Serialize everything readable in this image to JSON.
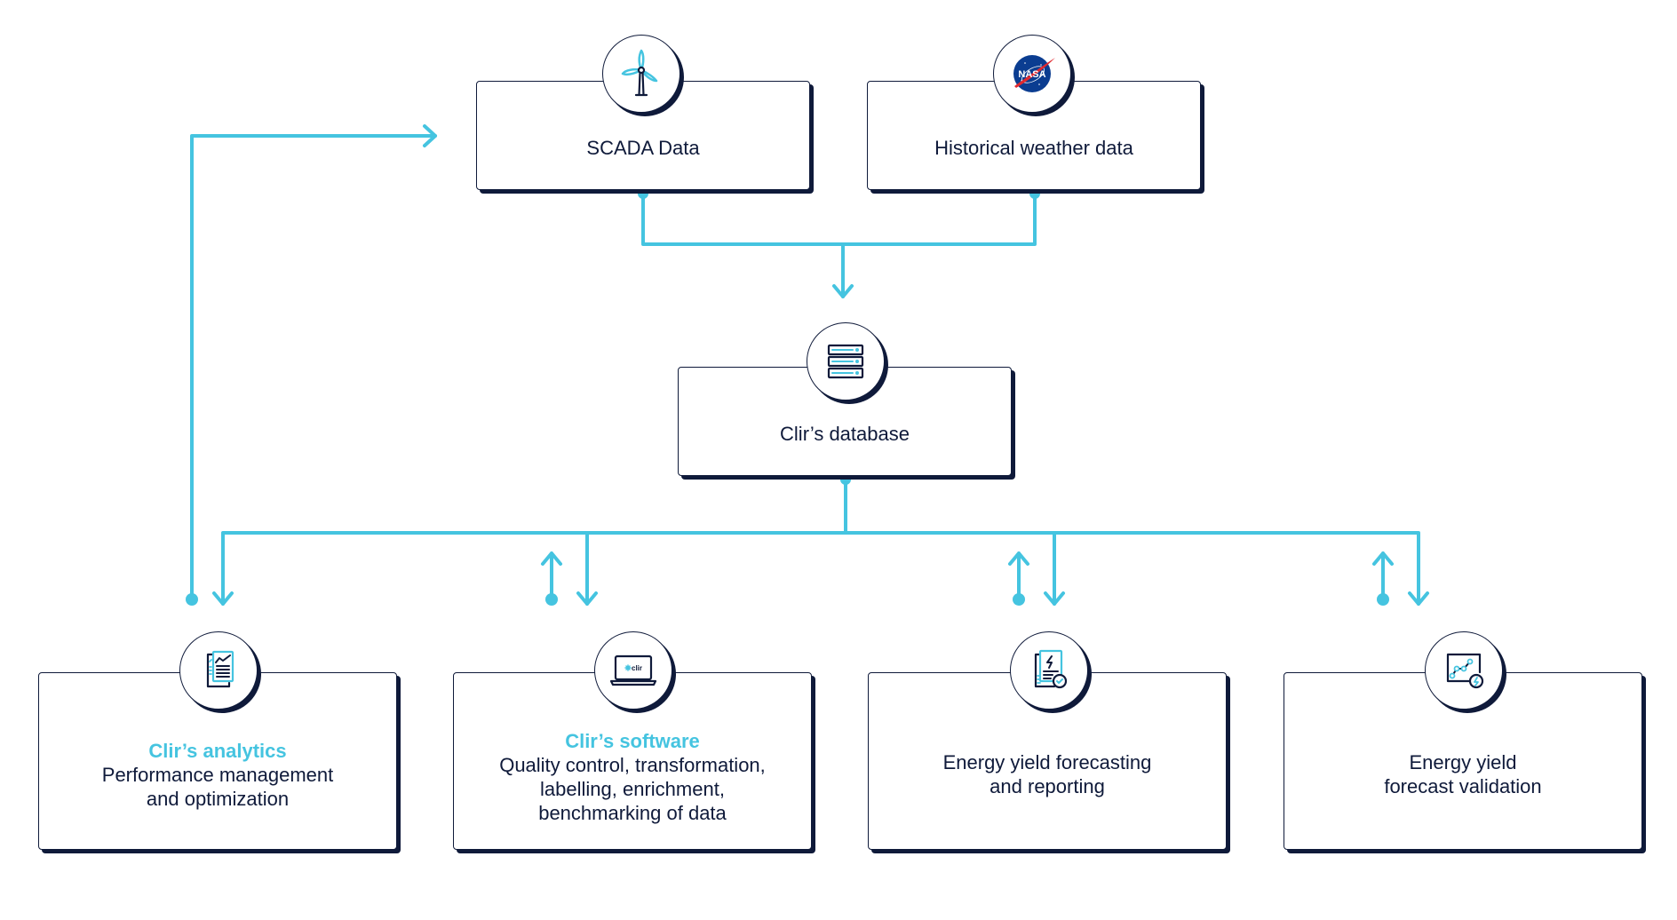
{
  "diagram": {
    "colors": {
      "navy": "#0f1a3a",
      "accent": "#45c4e0",
      "nasa_blue": "#0b3d91",
      "nasa_red": "#e0292f"
    },
    "sources": [
      {
        "id": "scada",
        "label": "SCADA Data",
        "icon": "wind-turbine-icon"
      },
      {
        "id": "weather",
        "label": "Historical weather data",
        "icon": "nasa-logo-icon"
      }
    ],
    "hub": {
      "id": "database",
      "label": "Clir’s database",
      "icon": "server-stack-icon"
    },
    "outputs": [
      {
        "id": "analytics",
        "title": "Clir’s analytics",
        "lines": [
          "Performance management",
          "and optimization"
        ],
        "icon": "report-chart-icon",
        "feedback_to": "SCADA Data"
      },
      {
        "id": "software",
        "title": "Clir’s software",
        "lines": [
          "Quality control, transformation,",
          "labelling, enrichment,",
          "benchmarking of data"
        ],
        "icon": "laptop-clir-icon",
        "laptop_brand": "clir"
      },
      {
        "id": "forecast",
        "title": "",
        "lines": [
          "Energy yield forecasting",
          "and reporting"
        ],
        "icon": "energy-report-check-icon"
      },
      {
        "id": "validate",
        "title": "",
        "lines": [
          "Energy yield",
          "forecast validation"
        ],
        "icon": "chart-validation-icon"
      }
    ],
    "edges": [
      {
        "from": "SCADA Data",
        "to": "Clir’s database"
      },
      {
        "from": "Historical weather data",
        "to": "Clir’s database"
      },
      {
        "from": "Clir’s database",
        "to": "Clir’s analytics"
      },
      {
        "from": "Clir’s database",
        "to": "Clir’s software",
        "bidirectional": true
      },
      {
        "from": "Clir’s database",
        "to": "Energy yield forecasting and reporting",
        "bidirectional": true
      },
      {
        "from": "Clir’s database",
        "to": "Energy yield forecast validation",
        "bidirectional": true
      },
      {
        "from": "Clir’s analytics",
        "to": "SCADA Data"
      }
    ]
  }
}
